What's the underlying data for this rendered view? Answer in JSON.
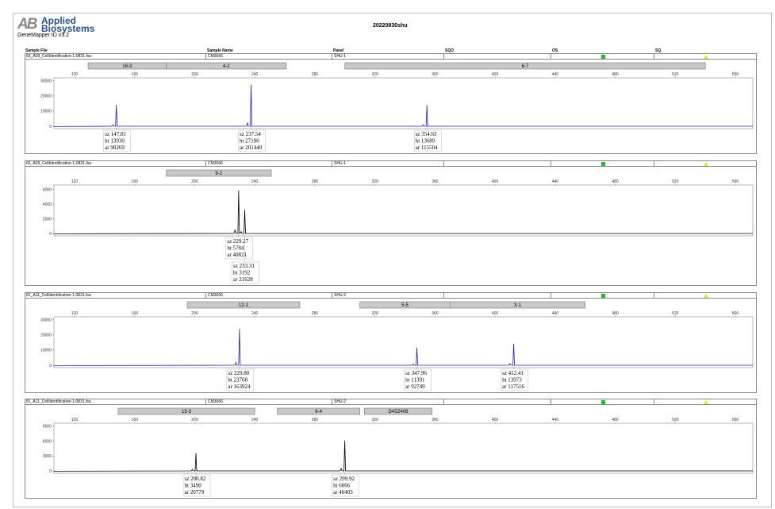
{
  "header": {
    "logo_text_1": "Applied",
    "logo_text_2": "Biosystems",
    "logo_mark": "AB",
    "version": "GeneMapper ID v3.2",
    "title": "20220830shu"
  },
  "columns": {
    "sample_file": "Sample File",
    "sample_name": "Sample Name",
    "panel": "Panel",
    "sqo": "SQO",
    "os": "OS",
    "sq": "SQ"
  },
  "colors": {
    "blue_trace": "#1a1adc",
    "black_trace": "#000000",
    "bin_fill": "#c8c8c8",
    "green": "#1ec21e",
    "yellow": "#f2e51a"
  },
  "panels": [
    {
      "sample_file": "65_A09_CellIdentification-1-0831.fsa",
      "sample_name": "CM3066",
      "panel": "SHU-1",
      "color": "blue",
      "bins": [
        {
          "label": "18-3",
          "start": 129,
          "end": 181
        },
        {
          "label": "4-2",
          "start": 181,
          "end": 261
        },
        {
          "label": "6-7",
          "start": 300,
          "end": 540
        }
      ],
      "peaks": [
        {
          "sz": "sz 147.81",
          "ht": "ht 13930",
          "ar": "ar 90269",
          "x": 147.81,
          "height": 13930
        },
        {
          "sz": "sz 237.54",
          "ht": "ht 27190",
          "ar": "ar 201440",
          "x": 237.54,
          "height": 27190
        },
        {
          "sz": "sz 354.63",
          "ht": "ht 13689",
          "ar": "ar 115504",
          "x": 354.63,
          "height": 13689
        }
      ],
      "y_ticks": [
        0,
        10000,
        20000,
        30000
      ],
      "y_max": 32000
    },
    {
      "sample_file": "65_A09_CellIdentification-1-0831.fsa",
      "sample_name": "CM3066",
      "panel": "SHU-1",
      "color": "black",
      "bins": [
        {
          "label": "9-2",
          "start": 181,
          "end": 251
        }
      ],
      "peaks": [
        {
          "sz": "sz 229.27",
          "ht": "ht 5784",
          "ar": "ar 40821",
          "x": 229.27,
          "height": 5784
        },
        {
          "sz": "sz 233.31",
          "ht": "ht 3192",
          "ar": "ar 21628",
          "x": 233.31,
          "height": 3192
        }
      ],
      "y_ticks": [
        0,
        2000,
        4000,
        6000
      ],
      "y_max": 6600
    },
    {
      "sample_file": "81_A11_CellIdentification-1-0831.fsa",
      "sample_name": "CM3066",
      "panel": "SHU-2",
      "color": "blue",
      "bins": [
        {
          "label": "12-1",
          "start": 195,
          "end": 270
        },
        {
          "label": "5-5",
          "start": 310,
          "end": 370
        },
        {
          "label": "X-1",
          "start": 370,
          "end": 460
        }
      ],
      "peaks": [
        {
          "sz": "sz 229.80",
          "ht": "ht 23768",
          "ar": "ar 163924",
          "x": 229.8,
          "height": 23768
        },
        {
          "sz": "sz 347.96",
          "ht": "ht 11391",
          "ar": "ar 92749",
          "x": 347.96,
          "height": 11391
        },
        {
          "sz": "sz 412.41",
          "ht": "ht 13973",
          "ar": "ar 117516",
          "x": 412.41,
          "height": 13973
        }
      ],
      "y_ticks": [
        0,
        10000,
        20000,
        30000
      ],
      "y_max": 32000
    },
    {
      "sample_file": "81_A11_CellIdentification-1-0831.fsa",
      "sample_name": "CM3066",
      "panel": "SHU-2",
      "color": "black",
      "bins": [
        {
          "label": "15-3",
          "start": 149,
          "end": 240
        },
        {
          "label": "6-4",
          "start": 255,
          "end": 310
        },
        {
          "label": "D4S2408",
          "start": 313,
          "end": 358
        }
      ],
      "peaks": [
        {
          "sz": "sz 200.82",
          "ht": "ht 3490",
          "ar": "ar 20779",
          "x": 200.82,
          "height": 3490
        },
        {
          "sz": "sz 299.92",
          "ht": "ht 6066",
          "ar": "ar 46403",
          "x": 299.92,
          "height": 6066
        }
      ],
      "y_ticks": [
        0,
        3000,
        6000,
        9000
      ],
      "y_max": 9600
    }
  ],
  "chart_data": [
    {
      "type": "line",
      "x_ticks": [
        120,
        160,
        200,
        240,
        280,
        320,
        360,
        400,
        440,
        480,
        520,
        560
      ],
      "xlim": [
        100,
        570
      ],
      "ylim": [
        0,
        32000
      ],
      "series": [
        {
          "values": [
            {
              "x": 147.81,
              "y": 13930
            },
            {
              "x": 237.54,
              "y": 27190
            },
            {
              "x": 354.63,
              "y": 13689
            }
          ]
        }
      ]
    },
    {
      "type": "line",
      "x_ticks": [
        120,
        160,
        200,
        240,
        280,
        320,
        360,
        400,
        440,
        480,
        520,
        560
      ],
      "xlim": [
        100,
        570
      ],
      "ylim": [
        0,
        6600
      ],
      "series": [
        {
          "values": [
            {
              "x": 229.27,
              "y": 5784
            },
            {
              "x": 233.31,
              "y": 3192
            }
          ]
        }
      ]
    },
    {
      "type": "line",
      "x_ticks": [
        120,
        160,
        200,
        240,
        280,
        320,
        360,
        400,
        440,
        480,
        520,
        560
      ],
      "xlim": [
        100,
        570
      ],
      "ylim": [
        0,
        32000
      ],
      "series": [
        {
          "values": [
            {
              "x": 229.8,
              "y": 23768
            },
            {
              "x": 347.96,
              "y": 11391
            },
            {
              "x": 412.41,
              "y": 13973
            }
          ]
        }
      ]
    },
    {
      "type": "line",
      "x_ticks": [
        120,
        160,
        200,
        240,
        280,
        320,
        360,
        400,
        440,
        480,
        520,
        560
      ],
      "xlim": [
        100,
        570
      ],
      "ylim": [
        0,
        9600
      ],
      "series": [
        {
          "values": [
            {
              "x": 200.82,
              "y": 3490
            },
            {
              "x": 299.92,
              "y": 6066
            }
          ]
        }
      ]
    }
  ]
}
